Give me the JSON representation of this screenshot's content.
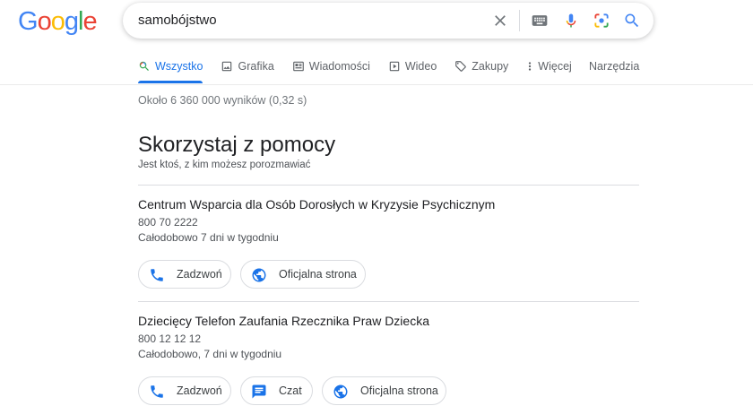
{
  "logo": {
    "letters": [
      "G",
      "o",
      "o",
      "g",
      "l",
      "e"
    ],
    "colors": [
      "#4285F4",
      "#EA4335",
      "#FBBC05",
      "#4285F4",
      "#34A853",
      "#EA4335"
    ]
  },
  "search": {
    "value": "samobójstwo"
  },
  "tabs": [
    {
      "label": "Wszystko",
      "icon": "search-icon",
      "active": true
    },
    {
      "label": "Grafika",
      "icon": "image-icon"
    },
    {
      "label": "Wiadomości",
      "icon": "news-icon"
    },
    {
      "label": "Wideo",
      "icon": "video-icon"
    },
    {
      "label": "Zakupy",
      "icon": "tag-icon"
    },
    {
      "label": "Więcej",
      "icon": "more-vert-icon"
    }
  ],
  "tools_label": "Narzędzia",
  "result_stats": "Około 6 360 000 wyników (0,32 s)",
  "help": {
    "title": "Skorzystaj z pomocy",
    "subtitle": "Jest ktoś, z kim możesz porozmawiać"
  },
  "orgs": [
    {
      "name": "Centrum Wsparcia dla Osób Dorosłych w Kryzysie Psychicznym",
      "phone": "800 70 2222",
      "hours": "Całodobowo 7 dni w tygodniu",
      "actions": [
        {
          "label": "Zadzwoń",
          "icon": "phone-icon"
        },
        {
          "label": "Oficjalna strona",
          "icon": "globe-icon"
        }
      ]
    },
    {
      "name": "Dziecięcy Telefon Zaufania Rzecznika Praw Dziecka",
      "phone": "800 12 12 12",
      "hours": "Całodobowo, 7 dni w tygodniu",
      "actions": [
        {
          "label": "Zadzwoń",
          "icon": "phone-icon"
        },
        {
          "label": "Czat",
          "icon": "chat-icon"
        },
        {
          "label": "Oficjalna strona",
          "icon": "globe-icon"
        }
      ]
    }
  ],
  "colors": {
    "accent": "#1a73e8",
    "icon_blue": "#1a73e8",
    "muted": "#70757a"
  }
}
